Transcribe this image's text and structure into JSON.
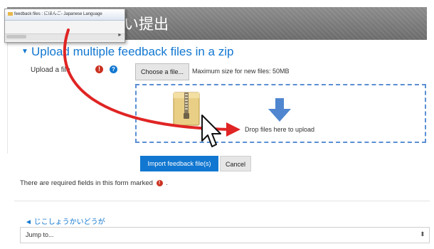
{
  "window": {
    "title": "feedback files : にほんご- Japanese Language"
  },
  "page": {
    "title": "い提出"
  },
  "section": {
    "heading": "Upload multiple feedback files in a zip"
  },
  "upload": {
    "label": "Upload a file",
    "required_icon": "!",
    "help_icon": "?",
    "choose_button": "Choose a file...",
    "max_size": "Maximum size for new files: 50MB",
    "drop_text": "Drop files here to upload"
  },
  "actions": {
    "import_label": "Import feedback file(s)",
    "cancel_label": "Cancel"
  },
  "form_note": {
    "before": "There are required fields in this form marked",
    "icon": "!",
    "after": "."
  },
  "nav": {
    "course_link": "◄ じこしょうかいどうが",
    "jump_to": "Jump to..."
  },
  "colors": {
    "accent": "#1177d1",
    "required": "#ca3120",
    "drag_arrow": "#e02424",
    "header": "#7a7a7a"
  },
  "icons": {
    "zip": "zip-folder-icon",
    "drop": "down-arrow-icon",
    "cursor": "mouse-pointer-icon",
    "collapse": "collapse-triangle-icon"
  }
}
